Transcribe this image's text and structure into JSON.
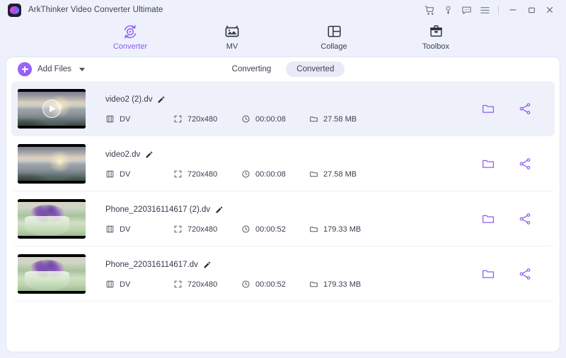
{
  "window": {
    "title": "ArkThinker Video Converter Ultimate",
    "app_icon": "app-logo-icon",
    "controls": {
      "cart": "cart-icon",
      "key": "key-icon",
      "feedback": "message-icon",
      "menu": "hamburger-menu-icon",
      "minimize": "minimize-icon",
      "maximize": "maximize-icon",
      "close": "close-icon"
    }
  },
  "nav": {
    "items": [
      {
        "label": "Converter",
        "icon": "converter-icon",
        "active": true
      },
      {
        "label": "MV",
        "icon": "mv-icon",
        "active": false
      },
      {
        "label": "Collage",
        "icon": "collage-icon",
        "active": false
      },
      {
        "label": "Toolbox",
        "icon": "toolbox-icon",
        "active": false
      }
    ]
  },
  "toolbar": {
    "add_files_label": "Add Files",
    "add_files_icon": "plus-icon",
    "dropdown_icon": "chevron-down-icon",
    "segments": [
      {
        "label": "Converting",
        "active": false
      },
      {
        "label": "Converted",
        "active": true
      }
    ]
  },
  "list": {
    "meta_icons": {
      "format": "film-icon",
      "resolution": "resize-icon",
      "duration": "clock-icon",
      "size": "folder-icon"
    },
    "row_actions": {
      "open_folder": "folder-icon",
      "share": "share-icon"
    },
    "edit_icon": "pencil-icon",
    "rows": [
      {
        "name": "video2 (2).dv",
        "format": "DV",
        "resolution": "720x480",
        "duration": "00:00:08",
        "size": "27.58 MB",
        "thumb": "beach",
        "selected": true,
        "playing": true
      },
      {
        "name": "video2.dv",
        "format": "DV",
        "resolution": "720x480",
        "duration": "00:00:08",
        "size": "27.58 MB",
        "thumb": "beach",
        "selected": false,
        "playing": false
      },
      {
        "name": "Phone_220316114617 (2).dv",
        "format": "DV",
        "resolution": "720x480",
        "duration": "00:00:52",
        "size": "179.33 MB",
        "thumb": "flowers",
        "selected": false,
        "playing": false
      },
      {
        "name": "Phone_220316114617.dv",
        "format": "DV",
        "resolution": "720x480",
        "duration": "00:00:52",
        "size": "179.33 MB",
        "thumb": "flowers",
        "selected": false,
        "playing": false
      }
    ]
  },
  "colors": {
    "accent": "#8b5cf6",
    "page_bg": "#eef1fb",
    "panel_bg": "#ffffff",
    "row_selected": "#eff1fa",
    "text": "#3b4050"
  }
}
